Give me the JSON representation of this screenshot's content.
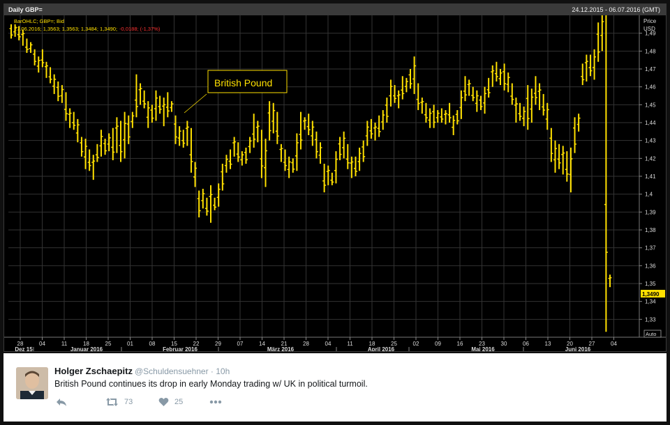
{
  "chart": {
    "header_left": "Daily GBP=",
    "header_right": "24.12.2015 - 06.07.2016 (GMT)",
    "legend_line1": "BarOHLC; GBP=; Bid",
    "legend_line2_main": "27.06.2016; 1,3563; 1,3563; 1,3484; 1,3490;",
    "legend_line2_change": "-0,0188; (-1,37%)",
    "annotation": "British Pound",
    "axis_title_1": "Price",
    "axis_title_2": "USD",
    "last_price_label": "1,3490",
    "auto_label": "Auto",
    "colors": {
      "bars": "#ffe000",
      "background": "#000000",
      "grid": "#3a3a3a",
      "change_negative": "#ff3333"
    }
  },
  "chart_data": {
    "type": "bar",
    "series": [
      {
        "name": "GBP=",
        "type": "ohlc"
      }
    ],
    "ylim": [
      1.32,
      1.5
    ],
    "y_ticks": [
      "1,49",
      "1,48",
      "1,47",
      "1,46",
      "1,45",
      "1,44",
      "1,43",
      "1,42",
      "1,41",
      "1,4",
      "1,39",
      "1,38",
      "1,37",
      "1,36",
      "1,35",
      "1,34",
      "1,33"
    ],
    "x_tick_labels": [
      "28",
      "04",
      "11",
      "18",
      "25",
      "01",
      "08",
      "15",
      "22",
      "29",
      "07",
      "14",
      "21",
      "28",
      "04",
      "11",
      "18",
      "25",
      "02",
      "09",
      "16",
      "23",
      "30",
      "06",
      "13",
      "20",
      "27",
      "04"
    ],
    "months": [
      "Dez 15",
      "Januar 2016",
      "Februar 2016",
      "März 2016",
      "April 2016",
      "Mai 2016",
      "Juni 2016"
    ],
    "bars": [
      {
        "h": 1.495,
        "l": 1.487
      },
      {
        "h": 1.495,
        "l": 1.488
      },
      {
        "h": 1.494,
        "l": 1.486
      },
      {
        "h": 1.492,
        "l": 1.483
      },
      {
        "h": 1.487,
        "l": 1.479
      },
      {
        "h": 1.485,
        "l": 1.479
      },
      {
        "h": 1.481,
        "l": 1.472
      },
      {
        "h": 1.477,
        "l": 1.468
      },
      {
        "h": 1.481,
        "l": 1.471
      },
      {
        "h": 1.474,
        "l": 1.465
      },
      {
        "h": 1.471,
        "l": 1.462
      },
      {
        "h": 1.467,
        "l": 1.456
      },
      {
        "h": 1.463,
        "l": 1.452
      },
      {
        "h": 1.461,
        "l": 1.451
      },
      {
        "h": 1.457,
        "l": 1.441
      },
      {
        "h": 1.448,
        "l": 1.437
      },
      {
        "h": 1.446,
        "l": 1.436
      },
      {
        "h": 1.442,
        "l": 1.429
      },
      {
        "h": 1.432,
        "l": 1.421
      },
      {
        "h": 1.431,
        "l": 1.414
      },
      {
        "h": 1.425,
        "l": 1.413
      },
      {
        "h": 1.422,
        "l": 1.408
      },
      {
        "h": 1.428,
        "l": 1.418
      },
      {
        "h": 1.436,
        "l": 1.421
      },
      {
        "h": 1.431,
        "l": 1.422
      },
      {
        "h": 1.434,
        "l": 1.424
      },
      {
        "h": 1.437,
        "l": 1.419
      },
      {
        "h": 1.443,
        "l": 1.423
      },
      {
        "h": 1.441,
        "l": 1.418
      },
      {
        "h": 1.446,
        "l": 1.42
      },
      {
        "h": 1.444,
        "l": 1.428
      },
      {
        "h": 1.446,
        "l": 1.437
      },
      {
        "h": 1.467,
        "l": 1.443
      },
      {
        "h": 1.462,
        "l": 1.45
      },
      {
        "h": 1.458,
        "l": 1.448
      },
      {
        "h": 1.452,
        "l": 1.437
      },
      {
        "h": 1.45,
        "l": 1.44
      },
      {
        "h": 1.458,
        "l": 1.441
      },
      {
        "h": 1.455,
        "l": 1.445
      },
      {
        "h": 1.454,
        "l": 1.438
      },
      {
        "h": 1.457,
        "l": 1.443
      },
      {
        "h": 1.452,
        "l": 1.446
      },
      {
        "h": 1.444,
        "l": 1.428
      },
      {
        "h": 1.438,
        "l": 1.427
      },
      {
        "h": 1.436,
        "l": 1.426
      },
      {
        "h": 1.441,
        "l": 1.427
      },
      {
        "h": 1.437,
        "l": 1.412
      },
      {
        "h": 1.418,
        "l": 1.404
      },
      {
        "h": 1.402,
        "l": 1.387
      },
      {
        "h": 1.403,
        "l": 1.392
      },
      {
        "h": 1.398,
        "l": 1.388
      },
      {
        "h": 1.405,
        "l": 1.384
      },
      {
        "h": 1.398,
        "l": 1.391
      },
      {
        "h": 1.406,
        "l": 1.393
      },
      {
        "h": 1.417,
        "l": 1.402
      },
      {
        "h": 1.422,
        "l": 1.412
      },
      {
        "h": 1.425,
        "l": 1.414
      },
      {
        "h": 1.432,
        "l": 1.421
      },
      {
        "h": 1.429,
        "l": 1.418
      },
      {
        "h": 1.424,
        "l": 1.416
      },
      {
        "h": 1.426,
        "l": 1.417
      },
      {
        "h": 1.432,
        "l": 1.423
      },
      {
        "h": 1.445,
        "l": 1.426
      },
      {
        "h": 1.441,
        "l": 1.429
      },
      {
        "h": 1.436,
        "l": 1.409
      },
      {
        "h": 1.431,
        "l": 1.404
      },
      {
        "h": 1.452,
        "l": 1.43
      },
      {
        "h": 1.451,
        "l": 1.434
      },
      {
        "h": 1.446,
        "l": 1.428
      },
      {
        "h": 1.428,
        "l": 1.418
      },
      {
        "h": 1.425,
        "l": 1.413
      },
      {
        "h": 1.421,
        "l": 1.409
      },
      {
        "h": 1.42,
        "l": 1.412
      },
      {
        "h": 1.434,
        "l": 1.413
      },
      {
        "h": 1.446,
        "l": 1.425
      },
      {
        "h": 1.443,
        "l": 1.436
      },
      {
        "h": 1.445,
        "l": 1.433
      },
      {
        "h": 1.441,
        "l": 1.427
      },
      {
        "h": 1.435,
        "l": 1.42
      },
      {
        "h": 1.429,
        "l": 1.417
      },
      {
        "h": 1.417,
        "l": 1.401
      },
      {
        "h": 1.416,
        "l": 1.405
      },
      {
        "h": 1.412,
        "l": 1.405
      },
      {
        "h": 1.424,
        "l": 1.406
      },
      {
        "h": 1.432,
        "l": 1.419
      },
      {
        "h": 1.435,
        "l": 1.42
      },
      {
        "h": 1.428,
        "l": 1.414
      },
      {
        "h": 1.421,
        "l": 1.409
      },
      {
        "h": 1.421,
        "l": 1.41
      },
      {
        "h": 1.426,
        "l": 1.413
      },
      {
        "h": 1.43,
        "l": 1.418
      },
      {
        "h": 1.441,
        "l": 1.427
      },
      {
        "h": 1.442,
        "l": 1.431
      },
      {
        "h": 1.44,
        "l": 1.43
      },
      {
        "h": 1.444,
        "l": 1.432
      },
      {
        "h": 1.447,
        "l": 1.436
      },
      {
        "h": 1.454,
        "l": 1.44
      },
      {
        "h": 1.464,
        "l": 1.449
      },
      {
        "h": 1.461,
        "l": 1.451
      },
      {
        "h": 1.458,
        "l": 1.448
      },
      {
        "h": 1.466,
        "l": 1.453
      },
      {
        "h": 1.465,
        "l": 1.457
      },
      {
        "h": 1.47,
        "l": 1.459
      },
      {
        "h": 1.477,
        "l": 1.456
      },
      {
        "h": 1.462,
        "l": 1.447
      },
      {
        "h": 1.454,
        "l": 1.445
      },
      {
        "h": 1.451,
        "l": 1.44
      },
      {
        "h": 1.448,
        "l": 1.437
      },
      {
        "h": 1.45,
        "l": 1.437
      },
      {
        "h": 1.447,
        "l": 1.44
      },
      {
        "h": 1.448,
        "l": 1.44
      },
      {
        "h": 1.447,
        "l": 1.439
      },
      {
        "h": 1.451,
        "l": 1.44
      },
      {
        "h": 1.444,
        "l": 1.433
      },
      {
        "h": 1.447,
        "l": 1.439
      },
      {
        "h": 1.458,
        "l": 1.442
      },
      {
        "h": 1.466,
        "l": 1.452
      },
      {
        "h": 1.464,
        "l": 1.455
      },
      {
        "h": 1.46,
        "l": 1.452
      },
      {
        "h": 1.458,
        "l": 1.446
      },
      {
        "h": 1.455,
        "l": 1.447
      },
      {
        "h": 1.46,
        "l": 1.445
      },
      {
        "h": 1.465,
        "l": 1.454
      },
      {
        "h": 1.472,
        "l": 1.46
      },
      {
        "h": 1.474,
        "l": 1.463
      },
      {
        "h": 1.47,
        "l": 1.461
      },
      {
        "h": 1.473,
        "l": 1.458
      },
      {
        "h": 1.468,
        "l": 1.457
      },
      {
        "h": 1.462,
        "l": 1.45
      },
      {
        "h": 1.454,
        "l": 1.44
      },
      {
        "h": 1.451,
        "l": 1.441
      },
      {
        "h": 1.449,
        "l": 1.438
      },
      {
        "h": 1.461,
        "l": 1.436
      },
      {
        "h": 1.459,
        "l": 1.44
      },
      {
        "h": 1.466,
        "l": 1.45
      },
      {
        "h": 1.462,
        "l": 1.447
      },
      {
        "h": 1.456,
        "l": 1.444
      },
      {
        "h": 1.451,
        "l": 1.436
      },
      {
        "h": 1.437,
        "l": 1.418
      },
      {
        "h": 1.43,
        "l": 1.412
      },
      {
        "h": 1.428,
        "l": 1.414
      },
      {
        "h": 1.427,
        "l": 1.411
      },
      {
        "h": 1.424,
        "l": 1.407
      },
      {
        "h": 1.426,
        "l": 1.401
      },
      {
        "h": 1.443,
        "l": 1.423
      },
      {
        "h": 1.445,
        "l": 1.435
      },
      {
        "h": 1.473,
        "l": 1.461
      },
      {
        "h": 1.478,
        "l": 1.463
      },
      {
        "h": 1.478,
        "l": 1.466
      },
      {
        "h": 1.481,
        "l": 1.464
      },
      {
        "h": 1.496,
        "l": 1.474
      },
      {
        "h": 1.502,
        "l": 1.48
      },
      {
        "h": 1.501,
        "l": 1.323
      },
      {
        "h": 1.355,
        "l": 1.348
      }
    ]
  },
  "tweet": {
    "name": "Holger Zschaepitz",
    "handle": "@Schuldensuehner · 10h",
    "text": "British Pound continues its drop in early Monday trading w/ UK in political turmoil.",
    "retweets": "73",
    "likes": "25",
    "icons": [
      "reply-icon",
      "retweet-icon",
      "heart-icon",
      "more-icon"
    ]
  }
}
